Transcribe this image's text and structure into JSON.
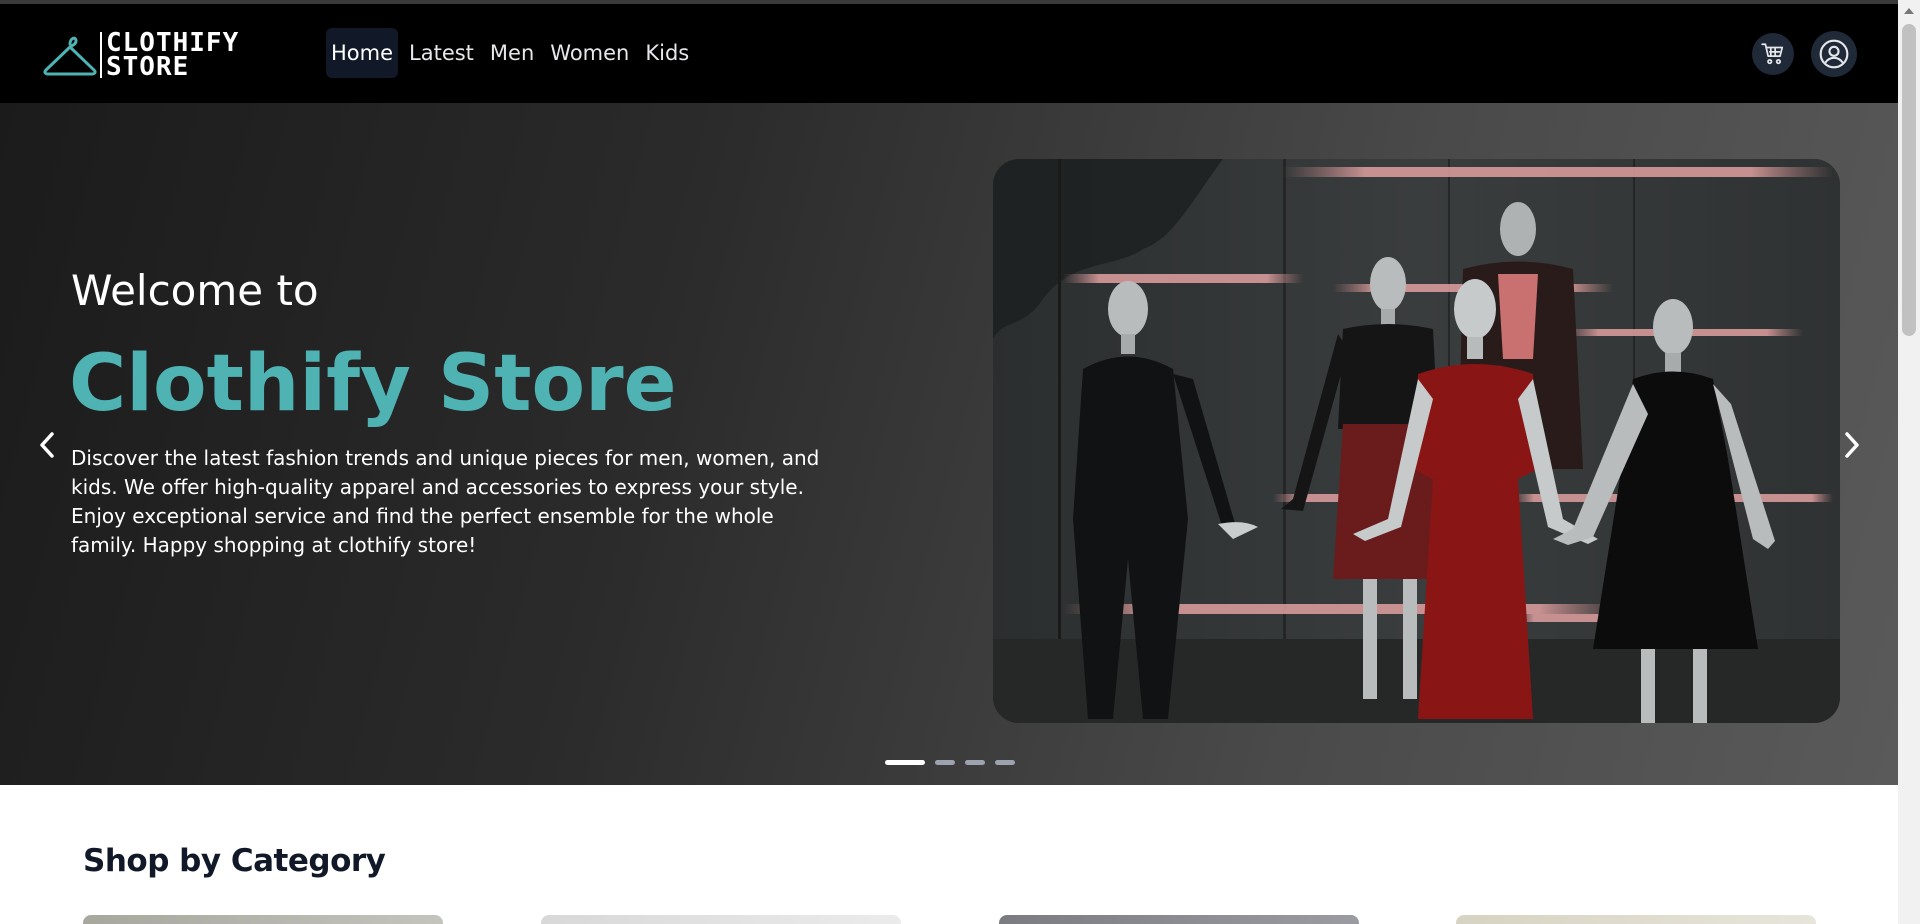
{
  "brand": {
    "line1": "CLOTHIFY",
    "line2": "STORE",
    "icon": "hanger-icon",
    "accent_color": "#4fb3b3"
  },
  "nav": {
    "links": [
      {
        "label": "Home",
        "active": true
      },
      {
        "label": "Latest",
        "active": false
      },
      {
        "label": "Men",
        "active": false
      },
      {
        "label": "Women",
        "active": false
      },
      {
        "label": "Kids",
        "active": false
      }
    ],
    "cart_icon": "cart-icon",
    "user_icon": "user-icon"
  },
  "hero": {
    "welcome": "Welcome to",
    "title": "Clothify Store",
    "description": "Discover the latest fashion trends and unique pieces for men, women, and kids. We offer high-quality apparel and accessories to express your style. Enjoy exceptional service and find the perfect ensemble for the whole family. Happy shopping at clothify store!",
    "prev_icon": "chevron-left-icon",
    "next_icon": "chevron-right-icon",
    "slide_count": 4,
    "active_slide": 1
  },
  "categories": {
    "title": "Shop by Category"
  }
}
